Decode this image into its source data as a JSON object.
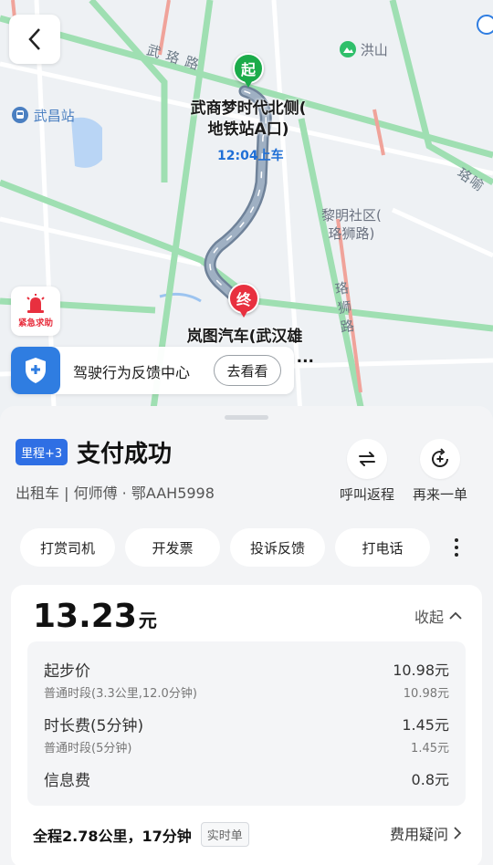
{
  "map": {
    "poi_hongshan": "洪山",
    "poi_wuchang_station": "武昌站",
    "road_wuluolu": "武 珞 路",
    "road_luoyu": "珞喻",
    "community": "黎明社区(\n珞狮路)",
    "community_line1": "黎明社区(",
    "community_line2": "珞狮路)",
    "road_luoshilu": "珞\n狮\n路",
    "road_luoshi_1": "珞",
    "road_luoshi_2": "狮",
    "road_luoshi_3": "路",
    "start_marker": "起",
    "end_marker": "终",
    "start_place_line1": "武商梦时代北侧(",
    "start_place_line2": "地铁站A口)",
    "pickup_time": "12:04上车",
    "end_place_line1": "岚图汽车(武汉雄",
    "end_place_line2": "...",
    "sos_label": "紧急求助",
    "feedback_text": "驾驶行为反馈中心",
    "feedback_button": "去看看"
  },
  "sheet": {
    "tag": "里程+3",
    "status": "支付成功",
    "driver_info": "出租车 | 何师傅 · 鄂AAH5998",
    "actions": [
      {
        "label": "呼叫返程",
        "icon": "return-trip-icon"
      },
      {
        "label": "再来一单",
        "icon": "reorder-icon"
      }
    ],
    "chips": [
      "打赏司机",
      "开发票",
      "投诉反馈",
      "打电话"
    ]
  },
  "fare": {
    "amount": "13.23",
    "unit": "元",
    "collapse_label": "收起",
    "items": [
      {
        "name": "起步价",
        "value": "10.98元",
        "sub": "普通时段(3.3公里,12.0分钟)",
        "sub_value": "10.98元"
      },
      {
        "name": "时长费(5分钟)",
        "value": "1.45元",
        "sub": "普通时段(5分钟)",
        "sub_value": "1.45元"
      },
      {
        "name": "信息费",
        "value": "0.8元"
      }
    ],
    "summary": "全程2.78公里，17分钟",
    "summary_badge": "实时单",
    "question_label": "费用疑问"
  },
  "colors": {
    "route": "#8395ab",
    "road_green": "#9fdfb2",
    "road_red": "#f0a39a",
    "accent_blue": "#2f6fe4",
    "start_green": "#1bab4a",
    "end_red": "#e8303f"
  }
}
